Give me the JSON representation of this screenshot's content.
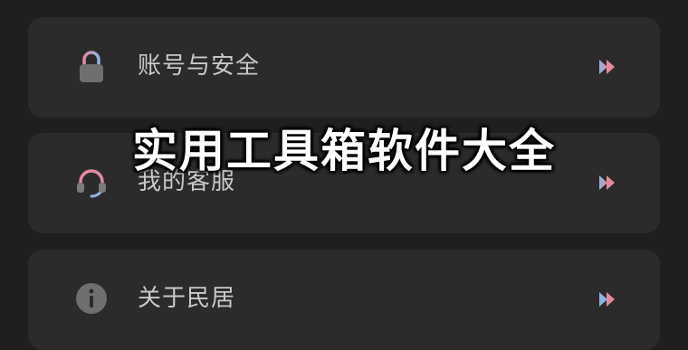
{
  "menu": {
    "items": [
      {
        "label": "账号与安全",
        "icon": "lock-icon",
        "arrow_icon": "double-chevron-right-icon"
      },
      {
        "label": "我的客服",
        "icon": "headset-icon",
        "arrow_icon": "double-chevron-right-icon"
      },
      {
        "label": "关于民居",
        "icon": "info-icon",
        "arrow_icon": "double-chevron-right-icon"
      }
    ]
  },
  "overlay": {
    "title": "实用工具箱软件大全"
  },
  "colors": {
    "background": "#1f1f1f",
    "card": "#2b2b2b",
    "label": "#c9c9c9",
    "overlay_text": "#ffffff",
    "icon_accent_pink": "#e58a9e",
    "icon_accent_blue": "#8fb4e3"
  }
}
